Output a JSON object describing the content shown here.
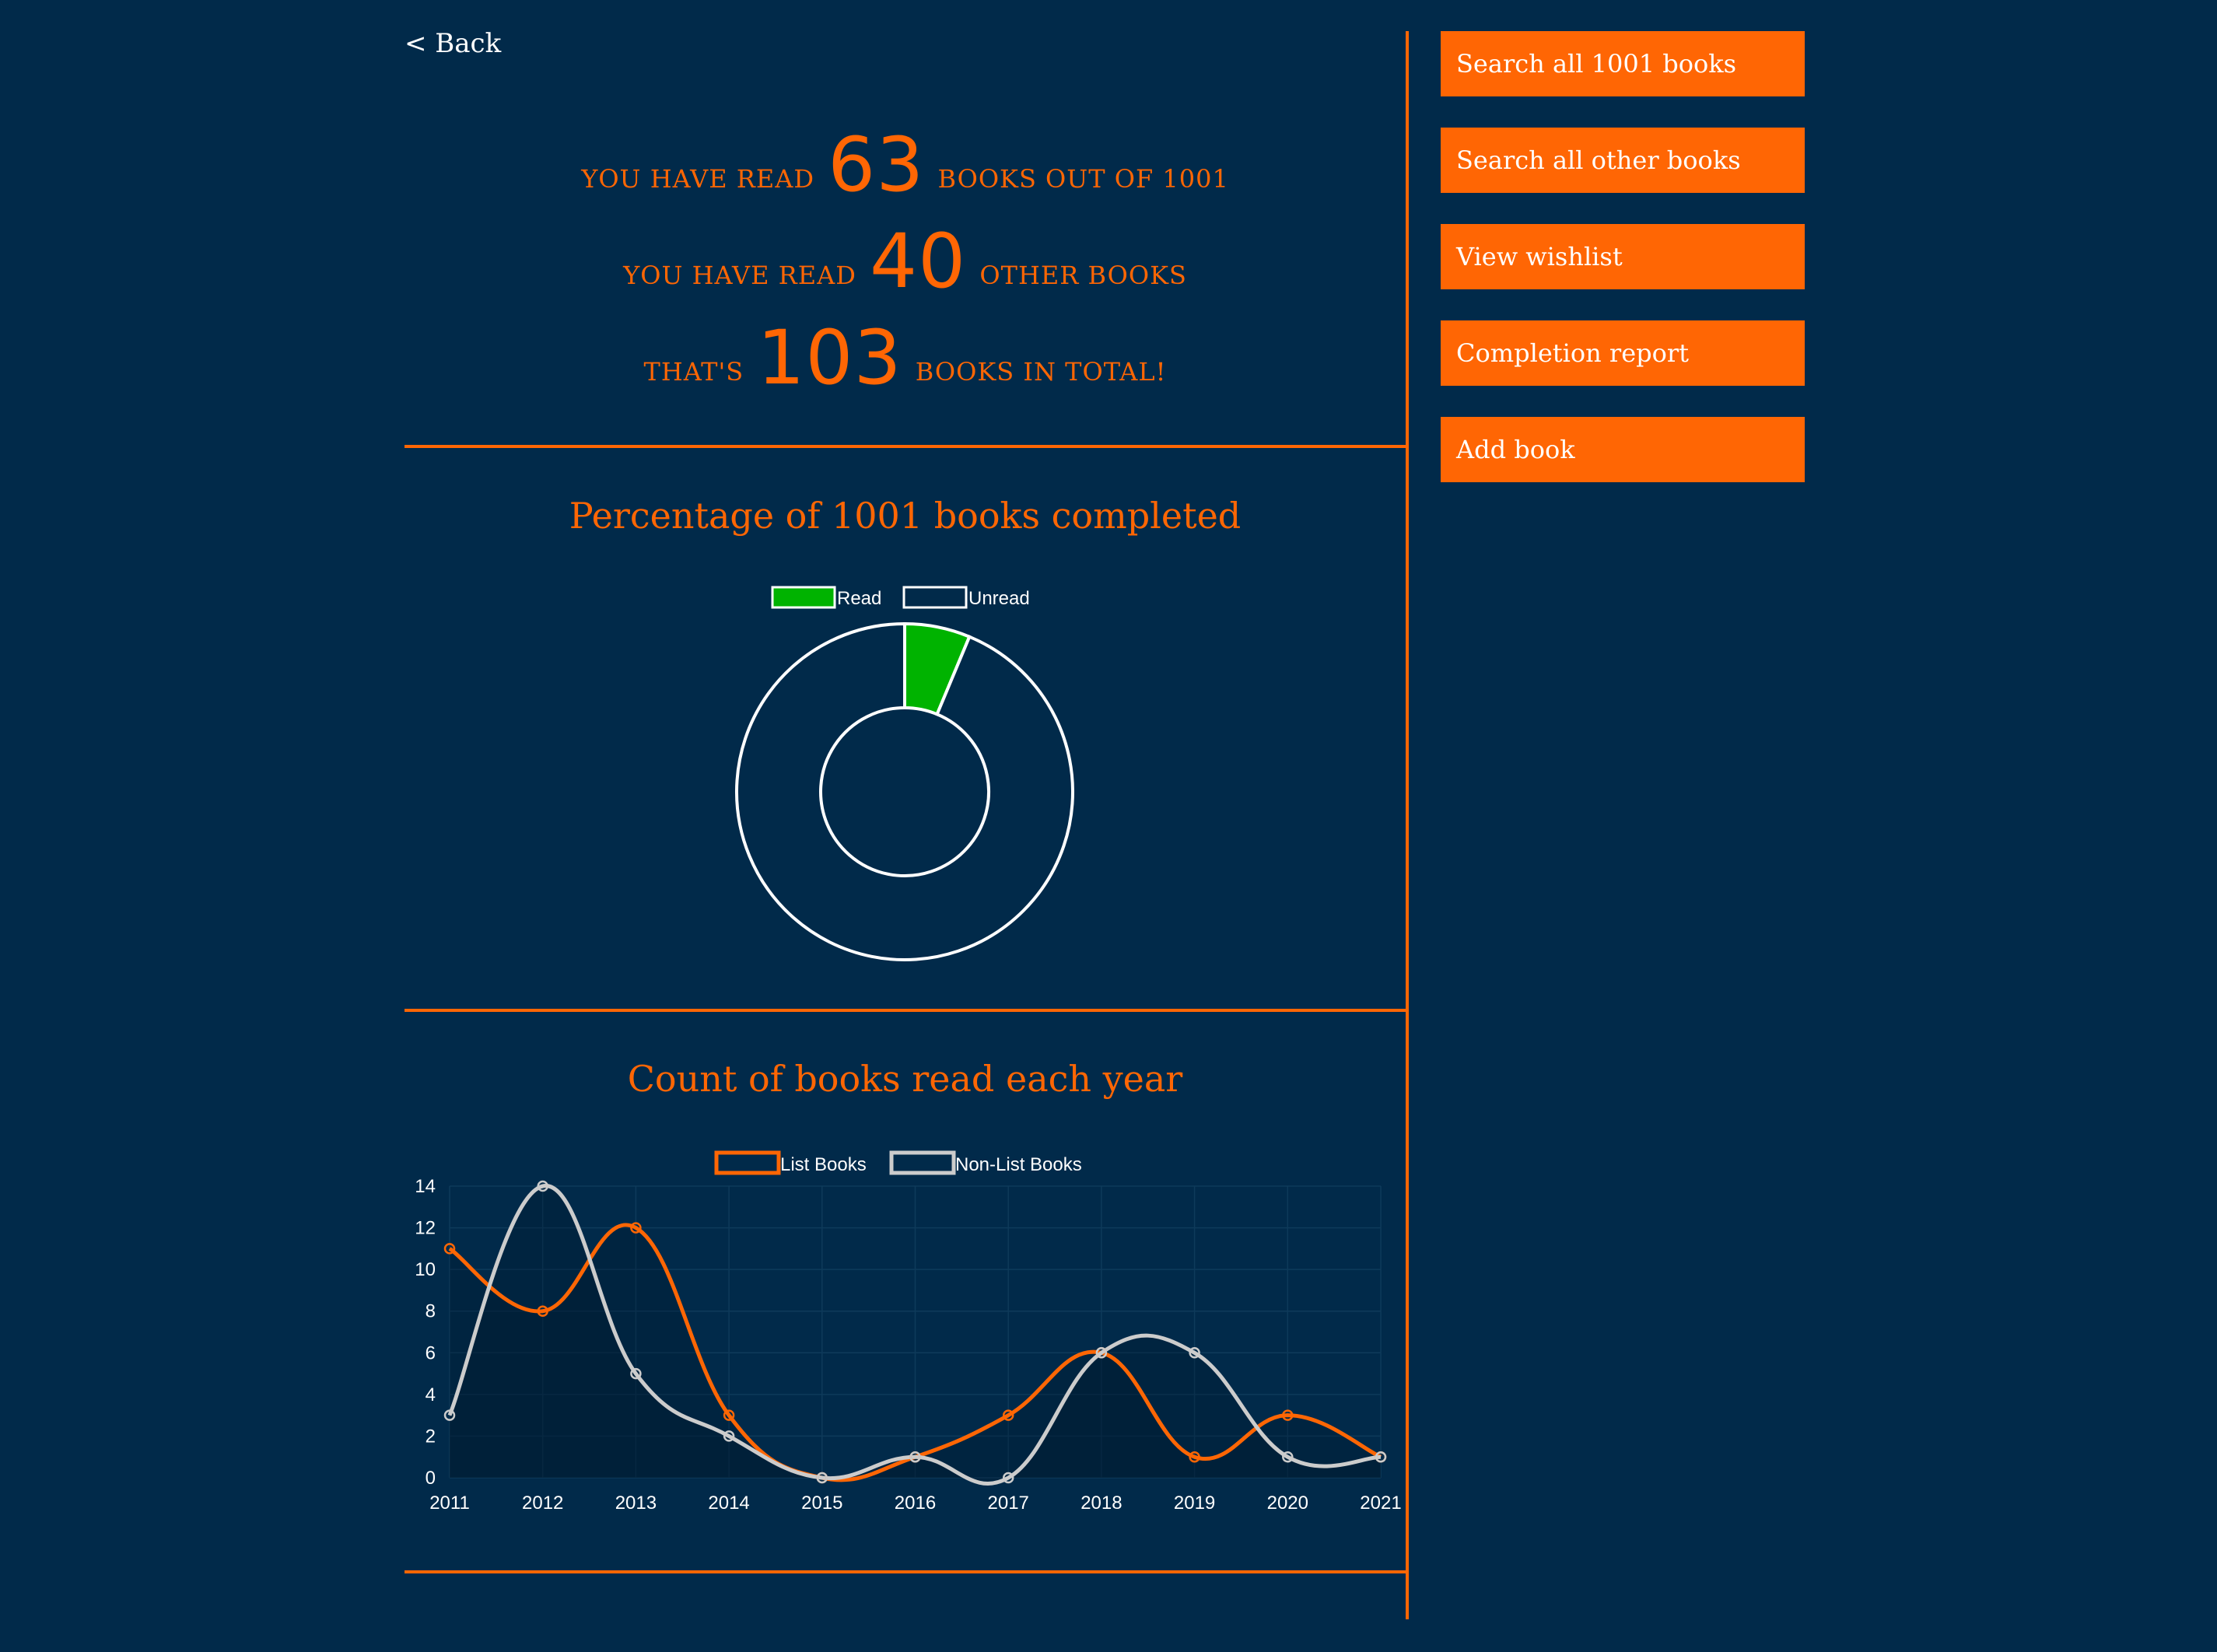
{
  "nav": {
    "back_label": "< Back"
  },
  "summary": {
    "line1": {
      "prefix": "YOU HAVE READ",
      "value": "63",
      "suffix": "BOOKS OUT OF 1001"
    },
    "line2": {
      "prefix": "YOU HAVE READ",
      "value": "40",
      "suffix": "OTHER BOOKS"
    },
    "line3": {
      "prefix": "THAT'S",
      "value": "103",
      "suffix": "BOOKS IN TOTAL!"
    }
  },
  "sidebar": {
    "buttons": [
      "Search all 1001 books",
      "Search all other books",
      "View wishlist",
      "Completion report",
      "Add book"
    ]
  },
  "colors": {
    "background": "#012a4a",
    "accent": "#ff6604",
    "read": "#00b300",
    "white": "#ffffff",
    "nonlist": "#cccccc"
  },
  "chart_data": [
    {
      "type": "pie",
      "title": "Percentage of 1001 books completed",
      "labels": [
        "Read",
        "Unread"
      ],
      "values": [
        63,
        938
      ],
      "colors": [
        "#00b300",
        "#012a4a"
      ],
      "legend": "top"
    },
    {
      "type": "line",
      "title": "Count of books read each year",
      "x": [
        "2011",
        "2012",
        "2013",
        "2014",
        "2015",
        "2016",
        "2017",
        "2018",
        "2019",
        "2020",
        "2021"
      ],
      "series": [
        {
          "name": "List Books",
          "values": [
            11,
            8,
            12,
            3,
            0,
            1,
            3,
            6,
            1,
            3,
            1
          ],
          "color": "#ff6604"
        },
        {
          "name": "Non-List Books",
          "values": [
            3,
            14,
            5,
            2,
            0,
            1,
            0,
            6,
            6,
            1,
            1
          ],
          "color": "#cccccc"
        }
      ],
      "yticks": [
        "0",
        "2",
        "4",
        "6",
        "8",
        "10",
        "12",
        "14"
      ],
      "ylim": [
        0,
        14
      ],
      "grid": true,
      "legend": "top"
    }
  ]
}
